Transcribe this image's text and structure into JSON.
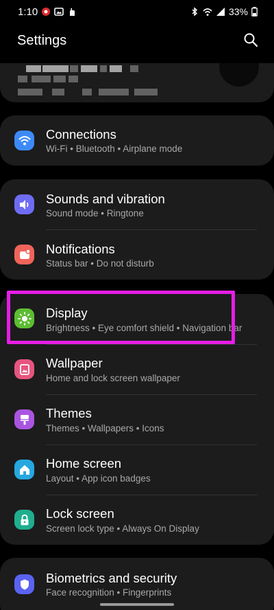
{
  "status_bar": {
    "time": "1:10",
    "battery": "33%",
    "left_icons": [
      "app-notification-icon",
      "image-icon",
      "hand-icon"
    ],
    "right_icons": [
      "bluetooth-icon",
      "wifi-icon",
      "signal-icon",
      "battery-icon"
    ]
  },
  "header": {
    "title": "Settings",
    "search_icon": "search-icon"
  },
  "items": [
    {
      "key": "connections",
      "title": "Connections",
      "subtitle": "Wi-Fi  •  Bluetooth  •  Airplane mode",
      "icon": "wifi-icon",
      "color": "#3d8af7"
    },
    {
      "key": "sounds",
      "title": "Sounds and vibration",
      "subtitle": "Sound mode  •  Ringtone",
      "icon": "speaker-icon",
      "color": "#6e6cf2"
    },
    {
      "key": "notifications",
      "title": "Notifications",
      "subtitle": "Status bar  •  Do not disturb",
      "icon": "notification-icon",
      "color": "#f0645a"
    },
    {
      "key": "display",
      "title": "Display",
      "subtitle": "Brightness  •  Eye comfort shield  •  Navigation bar",
      "icon": "sun-icon",
      "color": "#5dbd32"
    },
    {
      "key": "wallpaper",
      "title": "Wallpaper",
      "subtitle": "Home and lock screen wallpaper",
      "icon": "wallpaper-icon",
      "color": "#e7557e"
    },
    {
      "key": "themes",
      "title": "Themes",
      "subtitle": "Themes  •  Wallpapers  •  Icons",
      "icon": "paintbrush-icon",
      "color": "#a955e0"
    },
    {
      "key": "home_screen",
      "title": "Home screen",
      "subtitle": "Layout  •  App icon badges",
      "icon": "home-icon",
      "color": "#25a8e0"
    },
    {
      "key": "lock_screen",
      "title": "Lock screen",
      "subtitle": "Screen lock type  •  Always On Display",
      "icon": "lock-icon",
      "color": "#1fae8e"
    },
    {
      "key": "biometrics",
      "title": "Biometrics and security",
      "subtitle": "Face recognition  •  Fingerprints",
      "icon": "shield-icon",
      "color": "#5a63f0"
    }
  ],
  "colors": {
    "background": "#000000",
    "card": "#1c1c1c",
    "highlight": "#e51ee5",
    "subtitle": "#a8a8a8"
  }
}
